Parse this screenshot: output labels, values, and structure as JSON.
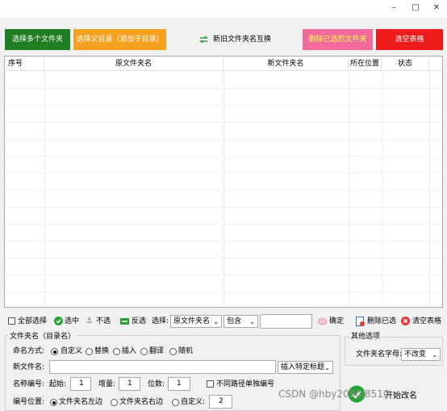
{
  "window": {
    "minimize_glyph": "–",
    "maximize_glyph": "□",
    "close_glyph": "✕"
  },
  "top_buttons": {
    "select_folders": "选择多个文件夹",
    "select_parent": "选择父目录（添加子目录）",
    "swap_names": "新旧文件夹名互换",
    "delete_selected": "删除已选的文件夹",
    "clear_table": "清空表格"
  },
  "colors": {
    "green": "#1f7d24",
    "orange": "#f5a11f",
    "pink": "#f26a9b",
    "red": "#ee1b1b"
  },
  "table": {
    "columns": [
      "序号",
      "原文件夹名",
      "新文件夹名",
      "所在位置",
      "状态"
    ]
  },
  "toolbar": {
    "select_all": "全部选择",
    "check": "选中",
    "uncheck": "不选",
    "invert": "反选",
    "select_label": "选择:",
    "field_value": "原文件夹名",
    "mode_value": "包含",
    "confirm": "确定",
    "delete_selected": "删除已选",
    "clear_table": "清空表格"
  },
  "naming": {
    "group_title": "文件夹名（目录名）",
    "method_label": "命名方式:",
    "methods": [
      "自定义",
      "替换",
      "插入",
      "翻译",
      "随机"
    ],
    "new_name_label": "新文件名:",
    "new_name_value": "",
    "insert_tag": "插入特定标题",
    "number_label": "名称编号:",
    "start_label": "起始:",
    "start_value": "1",
    "step_label": "增量:",
    "step_value": "1",
    "digits_label": "位数:",
    "digits_value": "1",
    "separate_numbering": "不同路径单独编号",
    "position_label": "编号位置:",
    "positions": [
      "文件夹名左边",
      "文件夹名右边",
      "自定义:"
    ],
    "custom_position_value": "2"
  },
  "other": {
    "group_title": "其他选项",
    "case_label": "文件夹名字母:",
    "case_value": "不改变"
  },
  "start_button": "开始改名",
  "watermark": "CSDN @hby2090/8510"
}
